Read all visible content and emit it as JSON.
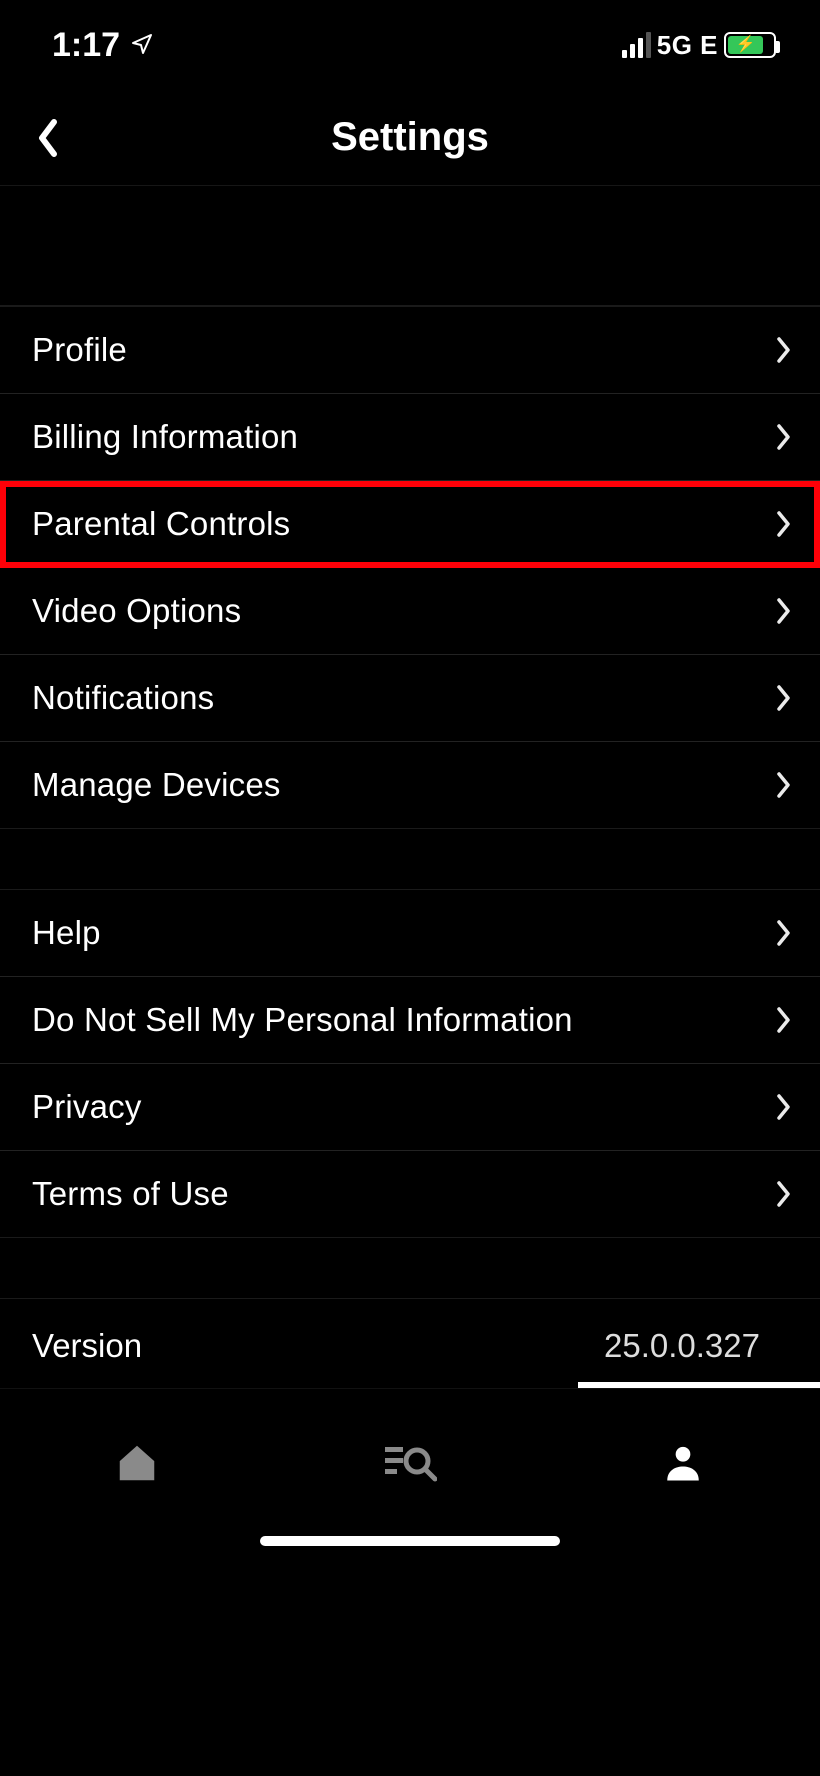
{
  "status": {
    "time": "1:17",
    "network": "5G E"
  },
  "header": {
    "title": "Settings"
  },
  "sections": [
    {
      "items": [
        {
          "label": "Profile",
          "highlight": false
        },
        {
          "label": "Billing Information",
          "highlight": false
        },
        {
          "label": "Parental Controls",
          "highlight": true
        },
        {
          "label": "Video Options",
          "highlight": false
        },
        {
          "label": "Notifications",
          "highlight": false
        },
        {
          "label": "Manage Devices",
          "highlight": false
        }
      ]
    },
    {
      "items": [
        {
          "label": "Help",
          "highlight": false
        },
        {
          "label": "Do Not Sell My Personal Information",
          "highlight": false
        },
        {
          "label": "Privacy",
          "highlight": false
        },
        {
          "label": "Terms of Use",
          "highlight": false
        }
      ]
    }
  ],
  "version": {
    "label": "Version",
    "value": "25.0.0.327"
  }
}
